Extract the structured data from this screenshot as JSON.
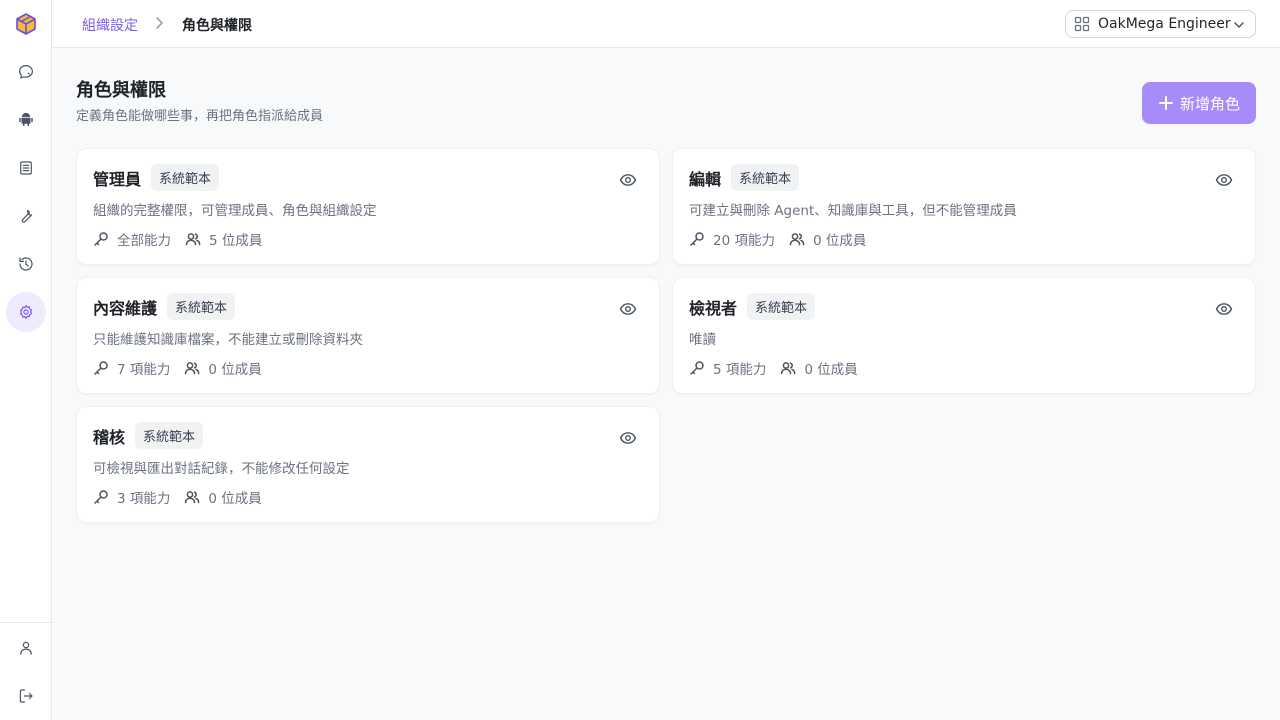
{
  "theme": {
    "accent": "#a78bfa",
    "accent_text": "#7c5cf0"
  },
  "sidebar": {
    "items": [
      {
        "name": "chat",
        "icon": "chat-icon"
      },
      {
        "name": "agents",
        "icon": "android-icon"
      },
      {
        "name": "knowledge",
        "icon": "document-icon"
      },
      {
        "name": "tools",
        "icon": "wrench-icon"
      },
      {
        "name": "history",
        "icon": "history-icon"
      },
      {
        "name": "settings",
        "icon": "gear-icon",
        "active": true
      }
    ],
    "bottom": [
      {
        "name": "profile",
        "icon": "user-icon"
      },
      {
        "name": "logout",
        "icon": "logout-icon"
      }
    ]
  },
  "breadcrumb": {
    "parent": "組織設定",
    "current": "角色與權限"
  },
  "org_selector": {
    "value": "OakMega Engineer"
  },
  "header": {
    "title": "角色與權限",
    "subtitle": "定義角色能做哪些事，再把角色指派給成員",
    "add_button": "新增角色"
  },
  "roles": [
    {
      "name": "管理員",
      "badge": "系統範本",
      "description": "組織的完整權限，可管理成員、角色與組織設定",
      "capabilities": "全部能力",
      "members": "5 位成員"
    },
    {
      "name": "編輯",
      "badge": "系統範本",
      "description": "可建立與刪除 Agent、知識庫與工具，但不能管理成員",
      "capabilities": "20 項能力",
      "members": "0 位成員"
    },
    {
      "name": "內容維護",
      "badge": "系統範本",
      "description": "只能維護知識庫檔案，不能建立或刪除資料夾",
      "capabilities": "7 項能力",
      "members": "0 位成員"
    },
    {
      "name": "檢視者",
      "badge": "系統範本",
      "description": "唯讀",
      "capabilities": "5 項能力",
      "members": "0 位成員"
    },
    {
      "name": "稽核",
      "badge": "系統範本",
      "description": "可檢視與匯出對話紀錄，不能修改任何設定",
      "capabilities": "3 項能力",
      "members": "0 位成員"
    }
  ]
}
